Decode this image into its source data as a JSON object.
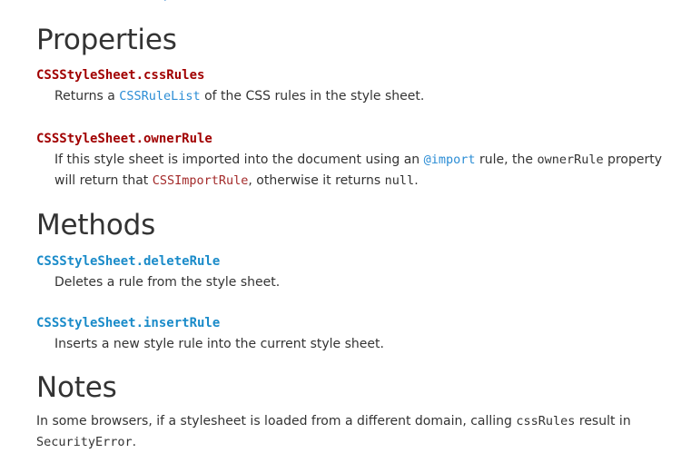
{
  "top_fragment": ")",
  "properties": {
    "heading": "Properties",
    "items": [
      {
        "term": "CSSStyleSheet.cssRules",
        "desc_prefix": "Returns a ",
        "desc_code": "CSSRuleList",
        "desc_suffix": " of the CSS rules in the style sheet."
      },
      {
        "term": "CSSStyleSheet.ownerRule",
        "desc_part1": "If this style sheet is imported into the document using an ",
        "desc_code1": "@import",
        "desc_part2": " rule, the ",
        "desc_code2": "ownerRule",
        "desc_part3": " property will return that ",
        "desc_code3": "CSSImportRule",
        "desc_part4": ", otherwise it returns ",
        "desc_code4": "null",
        "desc_part5": "."
      }
    ]
  },
  "methods": {
    "heading": "Methods",
    "items": [
      {
        "term": "CSSStyleSheet.deleteRule",
        "desc": "Deletes a rule from the style sheet."
      },
      {
        "term": "CSSStyleSheet.insertRule",
        "desc": "Inserts a new style rule into the current style sheet."
      }
    ]
  },
  "notes": {
    "heading": "Notes",
    "text_part1": "In some browsers, if a stylesheet is loaded from a different domain, calling ",
    "code1": "cssRules",
    "text_part2": " result in ",
    "code2": "SecurityError",
    "text_part3": "."
  },
  "colors": {
    "heading": "#333333",
    "term_property": "#a10000",
    "term_method": "#1a8bc9",
    "link_code": "#2b8dd5",
    "red_code": "#a32a2a"
  }
}
